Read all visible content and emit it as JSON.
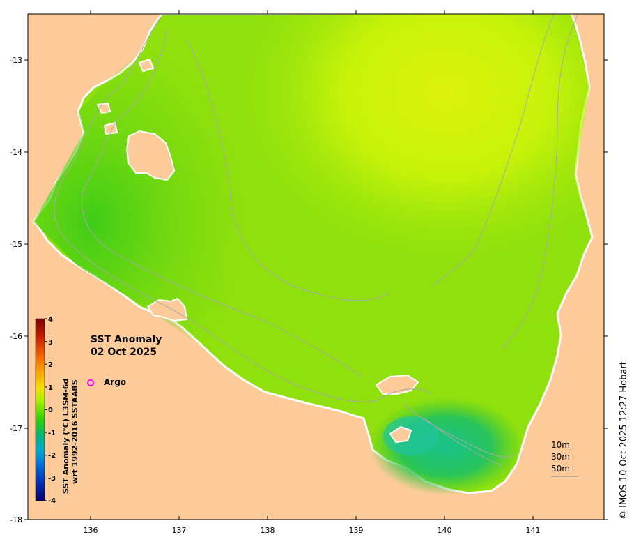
{
  "map": {
    "lon_ticks": [
      "136",
      "137",
      "138",
      "139",
      "140",
      "141"
    ],
    "lat_ticks": [
      "-13",
      "-14",
      "-15",
      "-16",
      "-17",
      "-18"
    ],
    "extent": {
      "lon_min": 135.3,
      "lon_max": 141.75,
      "lat_min": -18.0,
      "lat_max": -12.5
    },
    "colors": {
      "land": "#fdcb9a",
      "coast": "#ffffff",
      "bathy": "#a8a8a8",
      "ocean_warm": "#c9f50a",
      "ocean_mid": "#6bd60d",
      "ocean_cool": "#18c478"
    }
  },
  "title": {
    "line1": "SST Anomaly",
    "line2": "02 Oct 2025"
  },
  "argo": {
    "label": "Argo",
    "marker_color": "#ff00ff"
  },
  "depth_legend": {
    "items": [
      "10m",
      "30m",
      "50m"
    ]
  },
  "colorbar": {
    "ticks": [
      "4",
      "3",
      "2",
      "1",
      "0",
      "-1",
      "-2",
      "-3",
      "-4"
    ],
    "title_line1": "SST Anomaly (°C) L3SM-6d",
    "title_line2": "wrt 1992-2016 SSTAARS",
    "stops": [
      "#7a0000",
      "#c81e00",
      "#f06000",
      "#f5a800",
      "#f5e000",
      "#a8f000",
      "#30d000",
      "#00b080",
      "#00a8c8",
      "#0070d8",
      "#0030b0",
      "#000070"
    ]
  },
  "credit": "© IMOS 10-Oct-2025 12:27 Hobart"
}
